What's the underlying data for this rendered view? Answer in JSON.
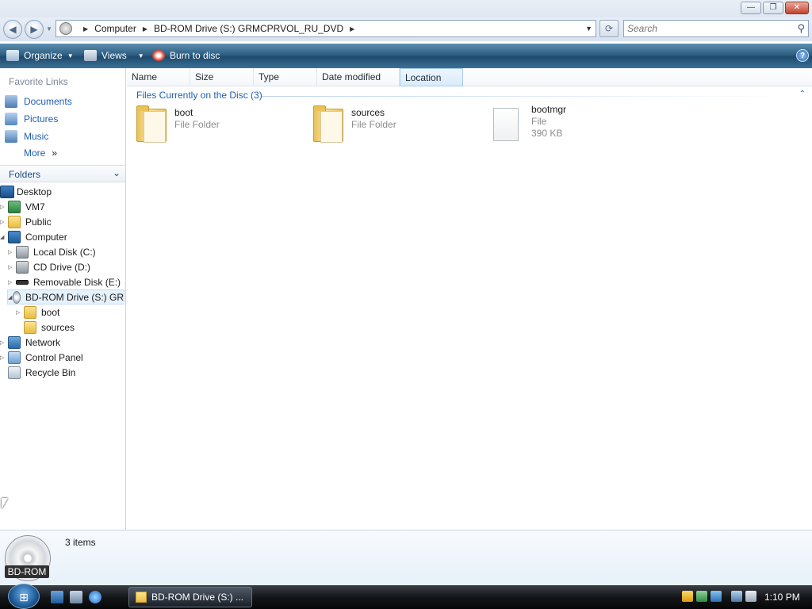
{
  "window": {
    "minimize_label": "—",
    "maximize_label": "❐",
    "close_label": "✕"
  },
  "address": {
    "back_label": "◀",
    "forward_label": "▶",
    "crumbs": [
      "Computer",
      "BD-ROM Drive (S:) GRMCPRVOL_RU_DVD"
    ],
    "refresh_label": "⟳",
    "search_placeholder": "Search",
    "search_icon": "magnifier-icon"
  },
  "toolbar": {
    "organize": "Organize",
    "views": "Views",
    "burn": "Burn to disc",
    "help": "?"
  },
  "favorites": {
    "title": "Favorite Links",
    "items": [
      {
        "label": "Documents",
        "icon": "documents-icon"
      },
      {
        "label": "Pictures",
        "icon": "pictures-icon"
      },
      {
        "label": "Music",
        "icon": "music-icon"
      },
      {
        "label": "More",
        "icon": "more-icon"
      }
    ],
    "more_arrows": "»"
  },
  "folders": {
    "title": "Folders",
    "toggle": "⌄",
    "tree": [
      {
        "label": "Desktop"
      },
      {
        "label": "VM7"
      },
      {
        "label": "Public"
      },
      {
        "label": "Computer"
      },
      {
        "label": "Local Disk (C:)"
      },
      {
        "label": "CD Drive (D:)"
      },
      {
        "label": "Removable Disk (E:)"
      },
      {
        "label": "BD-ROM Drive (S:) GR"
      },
      {
        "label": "boot"
      },
      {
        "label": "sources"
      },
      {
        "label": "Network"
      },
      {
        "label": "Control Panel"
      },
      {
        "label": "Recycle Bin"
      }
    ]
  },
  "columns": [
    "Name",
    "Size",
    "Type",
    "Date modified",
    "Location"
  ],
  "group": {
    "title": "Files Currently on the Disc (3)",
    "collapse": "⌃"
  },
  "files": [
    {
      "name": "boot",
      "type": "File Folder",
      "size": ""
    },
    {
      "name": "sources",
      "type": "File Folder",
      "size": ""
    },
    {
      "name": "bootmgr",
      "type": "File",
      "size": "390 KB"
    }
  ],
  "details": {
    "drive_label": "BD-ROM",
    "item_count": "3 items"
  },
  "taskbar": {
    "start_label": "⊞",
    "task_label": "BD-ROM Drive (S:) ...",
    "clock": "1:10 PM"
  }
}
